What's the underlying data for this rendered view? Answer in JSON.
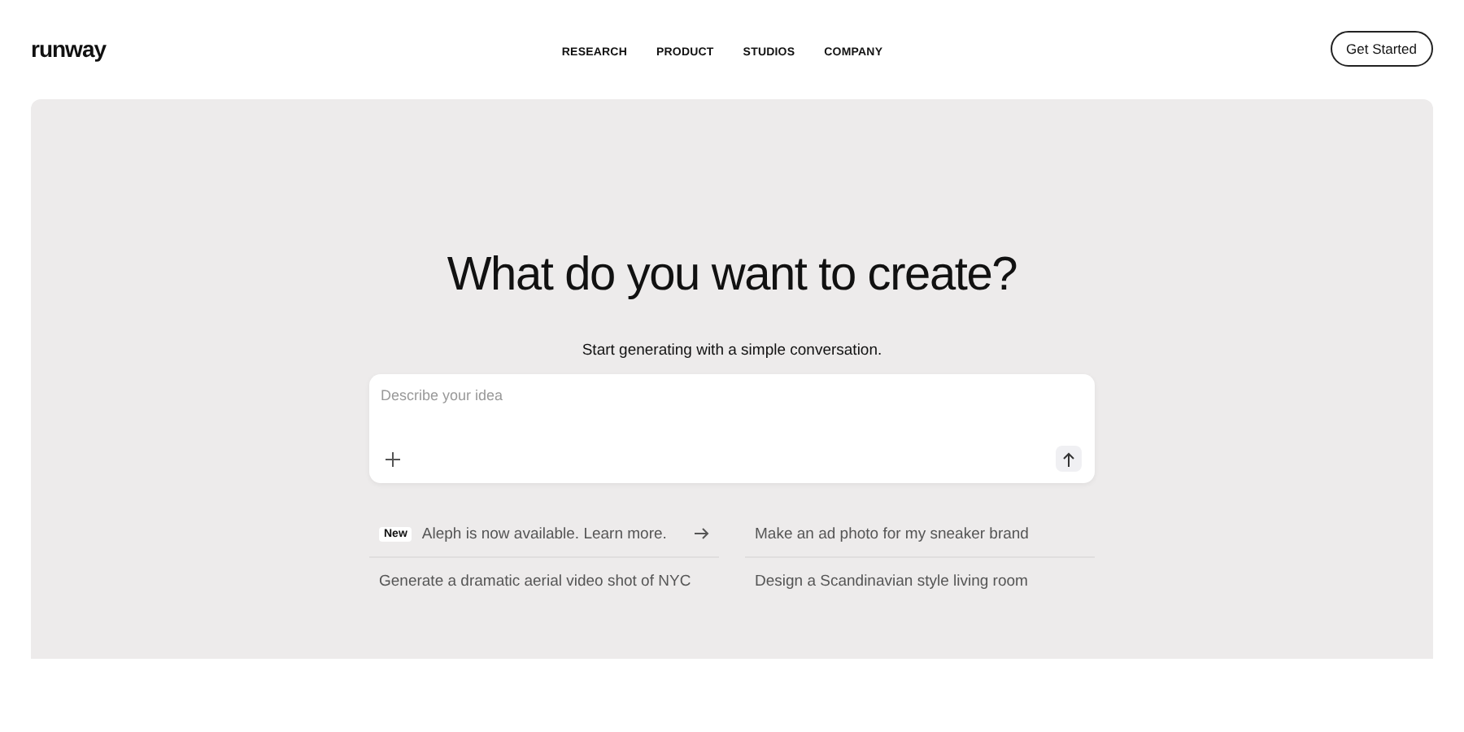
{
  "logo": "runway",
  "nav": [
    "RESEARCH",
    "PRODUCT",
    "STUDIOS",
    "COMPANY"
  ],
  "cta": "Get Started",
  "hero": {
    "title": "What do you want to create?",
    "subtitle": "Start generating with a simple conversation.",
    "prompt": {
      "placeholder": "Describe your idea"
    },
    "suggestions": [
      {
        "kind": "announcement",
        "badge": "New",
        "text": "Aleph is now available. Learn more."
      },
      {
        "kind": "prompt",
        "text": "Make an ad photo for my sneaker brand"
      },
      {
        "kind": "prompt",
        "text": "Generate a dramatic aerial video shot of NYC"
      },
      {
        "kind": "prompt",
        "text": "Design a Scandinavian style living room"
      }
    ]
  }
}
